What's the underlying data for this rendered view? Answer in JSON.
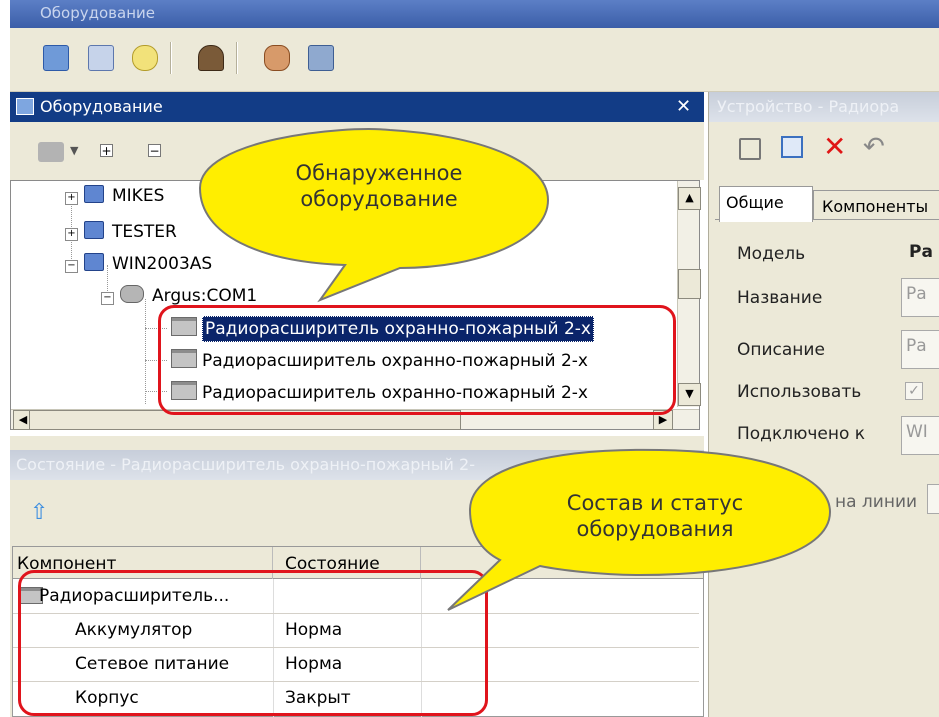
{
  "window": {
    "title": "Оборудование"
  },
  "equipment_panel": {
    "title": "Оборудование"
  },
  "tree": {
    "items": [
      {
        "label": "MIKES"
      },
      {
        "label": "TESTER"
      },
      {
        "label": "WIN2003AS"
      },
      {
        "label": "Argus:COM1"
      }
    ],
    "devices": [
      {
        "label": "Радиорасширитель охранно-пожарный 2-х"
      },
      {
        "label": "Радиорасширитель охранно-пожарный 2-х"
      },
      {
        "label": "Радиорасширитель охранно-пожарный 2-х"
      }
    ]
  },
  "state_panel": {
    "title": "Состояние  -  Радиорасширитель  охранно-пожарный  2-",
    "columns": [
      "Компонент",
      "Состояние"
    ],
    "rows": [
      {
        "component": "Радиорасширитель...",
        "state": ""
      },
      {
        "component": "Аккумулятор",
        "state": "Норма"
      },
      {
        "component": "Сетевое питание",
        "state": "Норма"
      },
      {
        "component": "Корпус",
        "state": "Закрыт"
      }
    ]
  },
  "device_panel": {
    "title": "Устройство - Радиора",
    "tabs": [
      "Общие",
      "Компоненты"
    ],
    "fields": {
      "model_label": "Модель",
      "model_value": "Ра",
      "name_label": "Название",
      "name_value": "Ра",
      "description_label": "Описание",
      "description_value": "Ра",
      "use_label": "Использовать",
      "connected_label": "Подключено к",
      "connected_value": "WI",
      "line_label": "на линии"
    }
  },
  "callouts": {
    "detected": "Обнаруженное\nоборудование",
    "status": "Состав и статус\nоборудования"
  },
  "colors": {
    "title_bar": "#123c86",
    "callout_fill": "#ffee00",
    "highlight_border": "#e0141c",
    "selection": "#0a246a"
  }
}
